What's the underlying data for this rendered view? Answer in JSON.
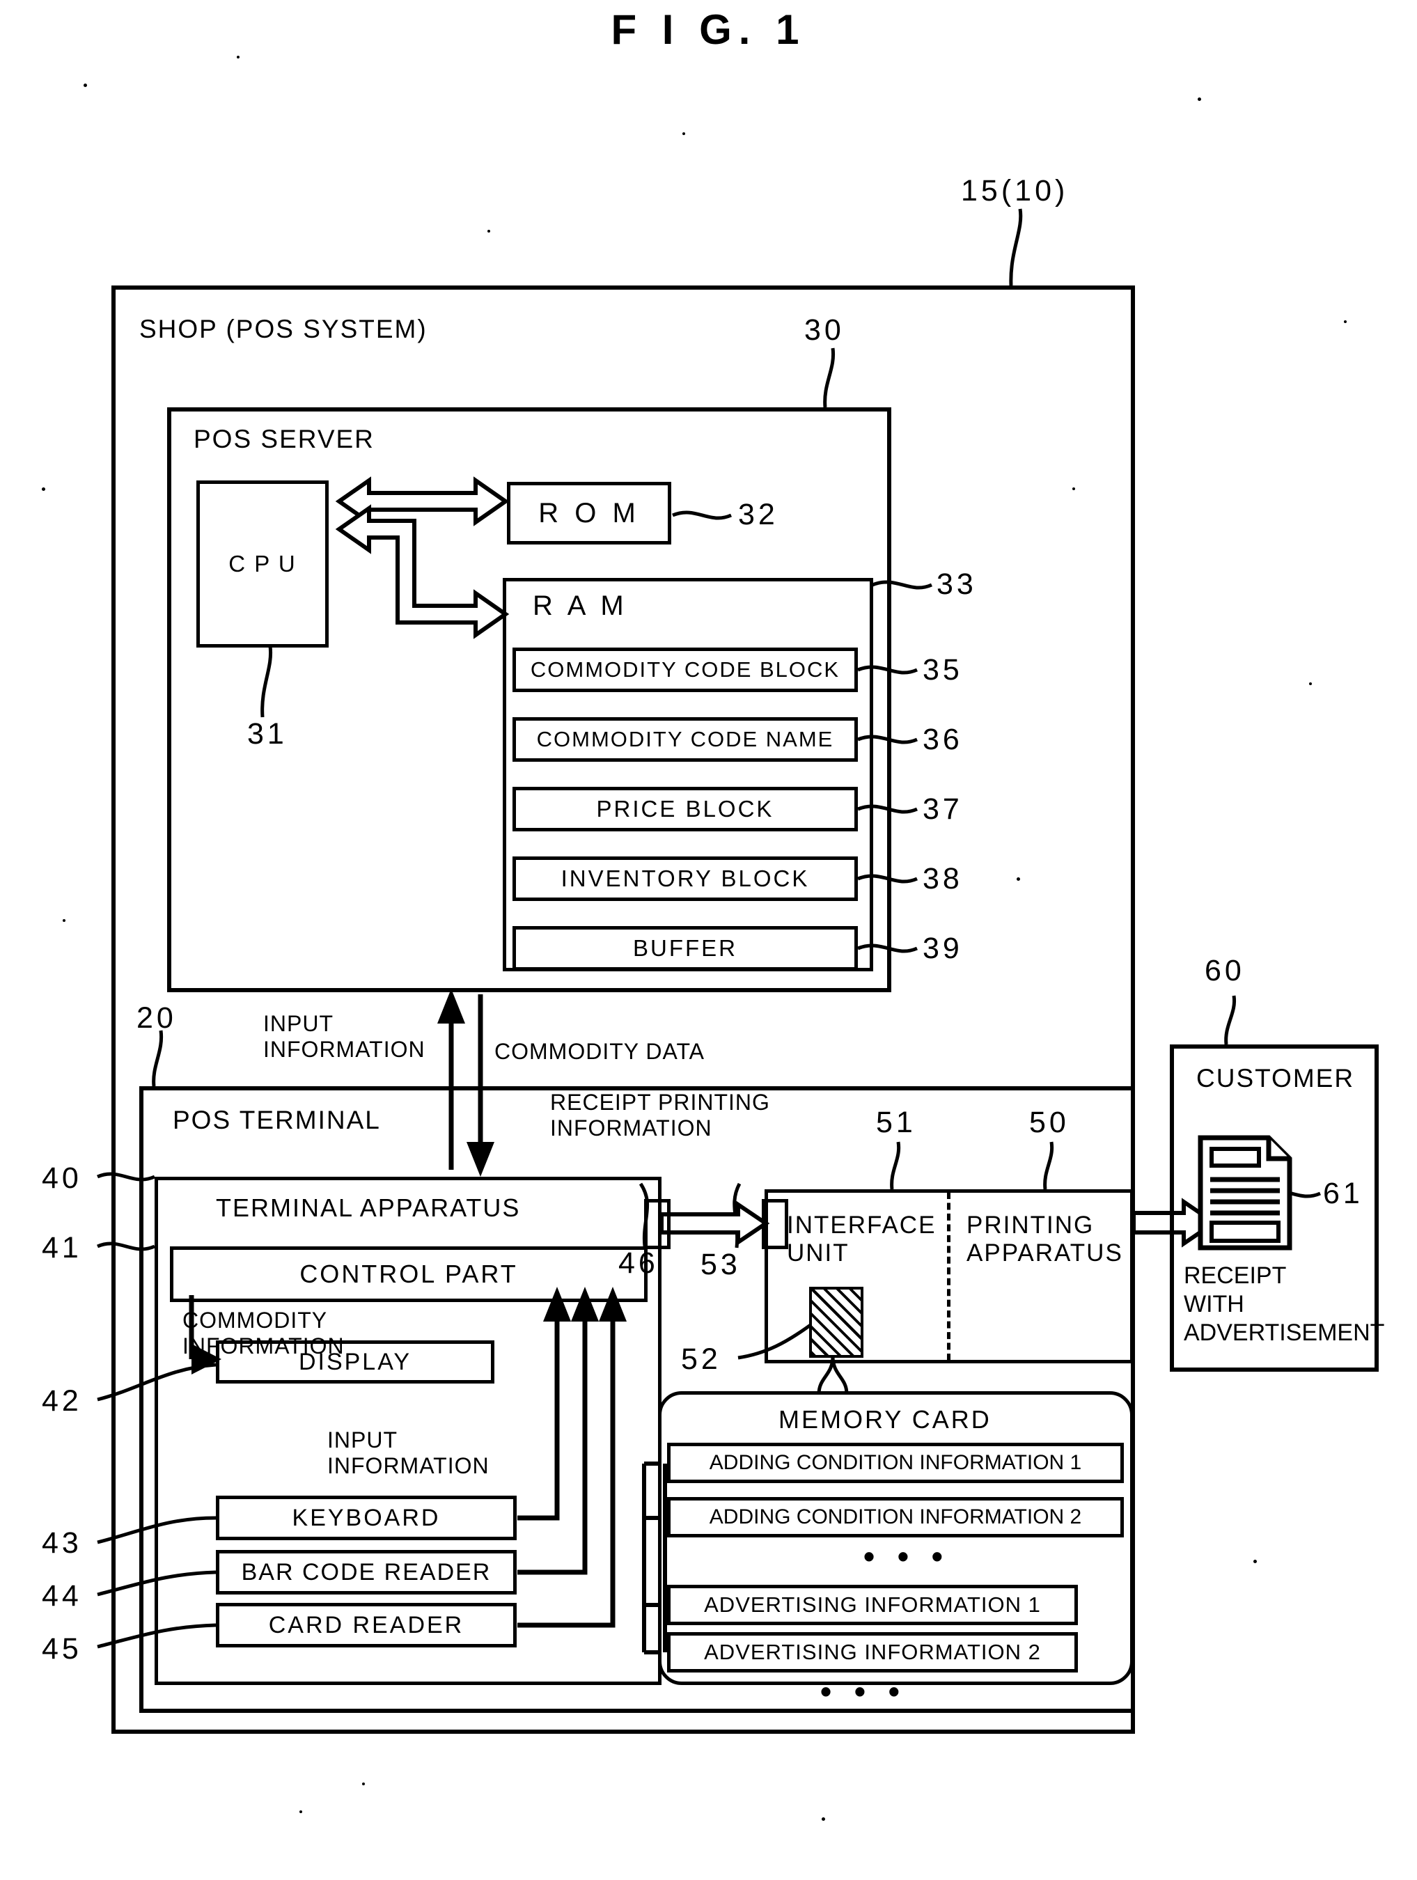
{
  "figure": {
    "title": "F I G.  1"
  },
  "refs": {
    "system": "15(10)",
    "pos_server": "30",
    "cpu": "31",
    "rom": "32",
    "ram": "33",
    "commodity_code_block": "35",
    "commodity_code_name": "36",
    "price_block": "37",
    "inventory_block": "38",
    "buffer": "39",
    "pos_terminal": "20",
    "terminal_apparatus": "40",
    "control_part": "41",
    "display": "42",
    "keyboard": "43",
    "bar_code_reader": "44",
    "card_reader": "45",
    "terminal_connector": "46",
    "printer_connector": "53",
    "memory_card_slot": "52",
    "interface_unit": "51",
    "printing_apparatus": "50",
    "customer": "60",
    "receipt": "61"
  },
  "shop": {
    "label": "SHOP (POS SYSTEM)"
  },
  "pos_server": {
    "label": "POS SERVER",
    "cpu": "C P U",
    "rom": "R O M",
    "ram": "R A M",
    "ram_blocks": [
      "COMMODITY CODE BLOCK",
      "COMMODITY CODE NAME",
      "PRICE BLOCK",
      "INVENTORY BLOCK",
      "BUFFER"
    ]
  },
  "flows": {
    "input_information_top": "INPUT\nINFORMATION",
    "commodity_data": "COMMODITY DATA",
    "receipt_printing_information": "RECEIPT PRINTING\nINFORMATION",
    "commodity_information": "COMMODITY\nINFORMATION",
    "input_information_lower": "INPUT\nINFORMATION"
  },
  "pos_terminal": {
    "label": "POS TERMINAL",
    "terminal_apparatus": "TERMINAL APPARATUS",
    "control_part": "CONTROL PART",
    "devices": [
      "DISPLAY",
      "KEYBOARD",
      "BAR CODE READER",
      "CARD READER"
    ]
  },
  "printer": {
    "interface_unit": "INTERFACE\nUNIT",
    "printing_apparatus": "PRINTING\nAPPARATUS"
  },
  "memory_card": {
    "label": "MEMORY CARD",
    "items": [
      "ADDING CONDITION INFORMATION 1",
      "ADDING CONDITION INFORMATION 2"
    ],
    "ellipsis_top": "• • •",
    "items2": [
      "ADVERTISING INFORMATION 1",
      "ADVERTISING INFORMATION 2"
    ],
    "ellipsis_bottom": "• • •"
  },
  "customer": {
    "label": "CUSTOMER",
    "caption": "RECEIPT\nWITH\nADVERTISEMENT"
  }
}
